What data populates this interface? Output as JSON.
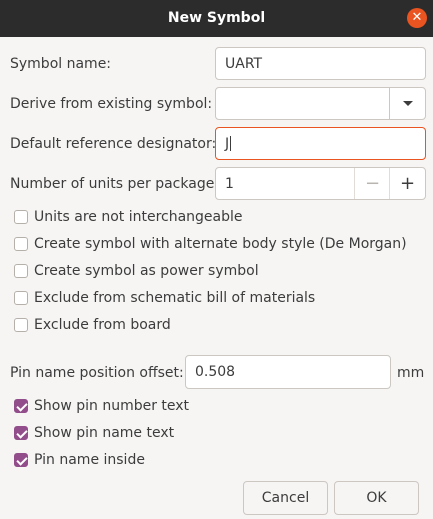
{
  "window": {
    "title": "New Symbol"
  },
  "form": {
    "symbol_name_label": "Symbol name:",
    "symbol_name_value": "UART",
    "derive_label": "Derive from existing symbol:",
    "derive_value": "",
    "ref_designator_label": "Default reference designator:",
    "ref_designator_value": "J",
    "units_label": "Number of units per package:",
    "units_value": "1",
    "units_minus": "−",
    "units_plus": "+"
  },
  "options": [
    {
      "label": "Units are not interchangeable",
      "checked": false
    },
    {
      "label": "Create symbol with alternate body style (De Morgan)",
      "checked": false
    },
    {
      "label": "Create symbol as power symbol",
      "checked": false
    },
    {
      "label": "Exclude from schematic bill of materials",
      "checked": false
    },
    {
      "label": "Exclude from board",
      "checked": false
    }
  ],
  "pin": {
    "offset_label": "Pin name position offset:",
    "offset_value": "0.508",
    "offset_unit": "mm",
    "show_number_label": "Show pin number text",
    "show_number_checked": true,
    "show_name_label": "Show pin name text",
    "show_name_checked": true,
    "name_inside_label": "Pin name inside",
    "name_inside_checked": true
  },
  "buttons": {
    "cancel": "Cancel",
    "ok": "OK"
  },
  "colors": {
    "accent": "#e95420",
    "checkbox_checked": "#924d8b",
    "titlebar": "#2c2c2c"
  }
}
